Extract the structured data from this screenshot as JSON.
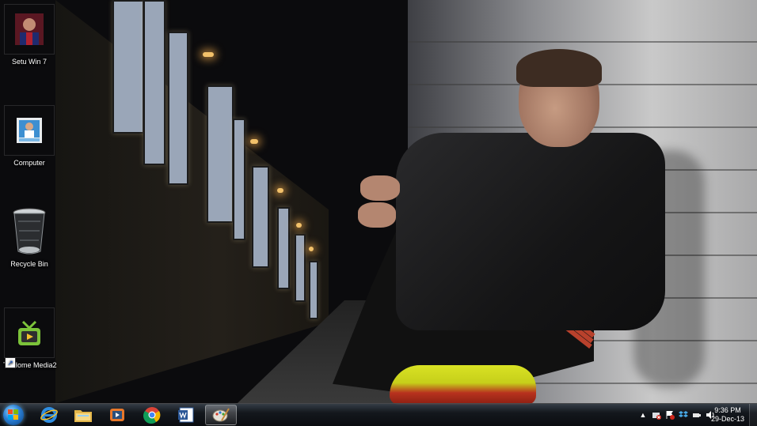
{
  "desktop": {
    "icons": [
      {
        "label": "Setu Win 7",
        "icon": "user-photo-icon"
      },
      {
        "label": "Computer",
        "icon": "computer-icon"
      },
      {
        "label": "Recycle Bin",
        "icon": "recycle-bin-icon"
      },
      {
        "label": "TVHome Media2",
        "icon": "tv-media-icon",
        "shortcut": true
      }
    ]
  },
  "taskbar": {
    "start": "start-orb-icon",
    "pinned": [
      {
        "name": "internet-explorer-icon",
        "color": "#2f8de0"
      },
      {
        "name": "file-explorer-icon",
        "color": "#e3b64a"
      },
      {
        "name": "media-player-icon",
        "color": "#e8772a"
      },
      {
        "name": "chrome-icon",
        "color": "#4a9d3f"
      },
      {
        "name": "word-icon",
        "color": "#2b5797"
      },
      {
        "name": "paint-icon",
        "color": "#c7c7c7",
        "active": true
      }
    ],
    "tray": {
      "icons": [
        "show-hidden-icons-chevron",
        "network-error-icon",
        "action-center-icon",
        "dropbox-icon",
        "power-icon",
        "volume-icon"
      ]
    },
    "clock": {
      "time": "9:36 PM",
      "date": "29-Dec-13"
    }
  }
}
